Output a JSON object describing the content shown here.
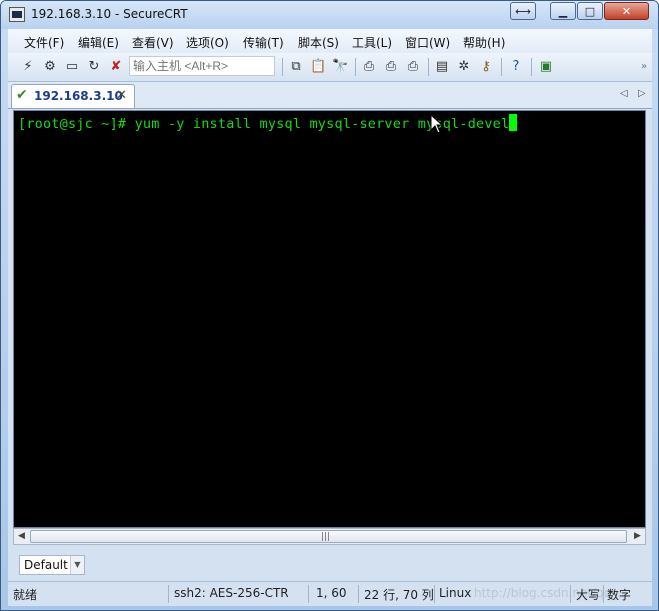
{
  "window": {
    "title": "192.168.3.10 - SecureCRT"
  },
  "menu": {
    "items": [
      "文件(F)",
      "编辑(E)",
      "查看(V)",
      "选项(O)",
      "传输(T)",
      "脚本(S)",
      "工具(L)",
      "窗口(W)",
      "帮助(H)"
    ]
  },
  "toolbar": {
    "host_placeholder": "输入主机 <Alt+R>",
    "icons": [
      "connect-icon",
      "quick-connect-icon",
      "connect-in-tab-icon",
      "reconnect-icon",
      "disconnect-icon",
      "copy-icon",
      "paste-icon",
      "find-icon",
      "print-icon",
      "print-selection-icon",
      "print-setup-icon",
      "session-options-icon",
      "global-options-icon",
      "keymap-icon",
      "help-icon",
      "sftp-icon"
    ]
  },
  "tabs": [
    {
      "label": "192.168.3.10",
      "connected": true
    }
  ],
  "terminal": {
    "prompt": "[root@sjc ~]# ",
    "command": "yum -y install mysql mysql-server mysql-devel",
    "text_color": "#17d917",
    "background": "#000000"
  },
  "command_bar": {
    "session": "Default"
  },
  "status": {
    "ready": "就绪",
    "protocol": "ssh2: AES-256-CTR",
    "position": "1,  60",
    "size": "22 行, 70 列",
    "os": "Linux",
    "watermark": "http://blog.csdn.net/qq_...",
    "caps": "大写",
    "num": "数字"
  }
}
